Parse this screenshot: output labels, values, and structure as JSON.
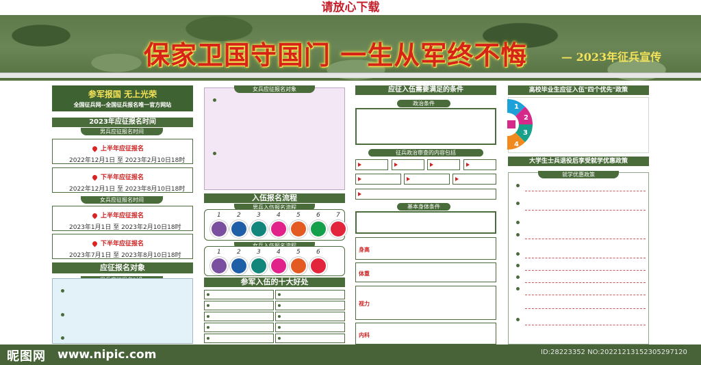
{
  "top_note": "请放心下载",
  "banner": {
    "title": "保家卫国守国门 一生从军终不悔",
    "subtitle": "— 2023年征兵宣传"
  },
  "col1": {
    "slogan1": "参军报国 无上光荣",
    "slogan2": "全国征兵网--全国征兵报名唯一官方网站",
    "time_title": "2023年应征报名时间",
    "male_time_label": "男兵应征报名时间",
    "female_time_label": "女兵应征报名时间",
    "male_entries": [
      {
        "title": "上半年应征报名",
        "date": "2022年12月1日 至 2023年2月10日18时"
      },
      {
        "title": "下半年应征报名",
        "date": "2022年12月1日 至 2023年8月10日18时"
      }
    ],
    "female_entries": [
      {
        "title": "上半年应征报名",
        "date": "2023年1月1日 至 2023年2月10日18时"
      },
      {
        "title": "下半年应征报名",
        "date": "2023年7月1日 至 2023年8月10日18时"
      }
    ],
    "target_title": "应征报名对象",
    "male_target_label": "男兵应征报名对象"
  },
  "col2": {
    "female_target_label": "女兵应征报名对象",
    "process_title": "入伍报名流程",
    "male_process_label": "男兵入伍报名流程",
    "female_process_label": "女兵入伍报名流程",
    "male_steps": [
      "1",
      "2",
      "3",
      "4",
      "5",
      "6",
      "7"
    ],
    "female_steps": [
      "1",
      "2",
      "3",
      "4",
      "5",
      "6"
    ],
    "male_colors": [
      "#7b4fa0",
      "#1f5fa8",
      "#12867a",
      "#e0228a",
      "#e35a23",
      "#14a04a",
      "#e2253a"
    ],
    "female_colors": [
      "#7b4fa0",
      "#1f5fa8",
      "#12867a",
      "#e0228a",
      "#e35a23",
      "#e2253a"
    ],
    "benefits_title": "参军入伍的十大好处"
  },
  "col3": {
    "title": "应征入伍需要满足的条件",
    "political_label": "政治条件",
    "review_label": "征兵政治审查的内容包括",
    "physical_label": "基本身体条件",
    "items": [
      "身高",
      "体重",
      "视力",
      "内科"
    ]
  },
  "col4": {
    "title": "高校毕业生应征入伍\"四个优先\"政策",
    "wheel": [
      {
        "n": "1",
        "color": "#1ea0d8"
      },
      {
        "n": "2",
        "color": "#d62a8a"
      },
      {
        "n": "3",
        "color": "#18a08a"
      },
      {
        "n": "4",
        "color": "#f08a1e"
      }
    ],
    "title2": "大学生士兵退役后享受就学优惠政策",
    "policy_label": "就学优惠政策"
  },
  "watermark": {
    "logo": "昵图网",
    "url": "www.nipic.com",
    "id": "ID:28223352 NO:20221213152305297120"
  }
}
